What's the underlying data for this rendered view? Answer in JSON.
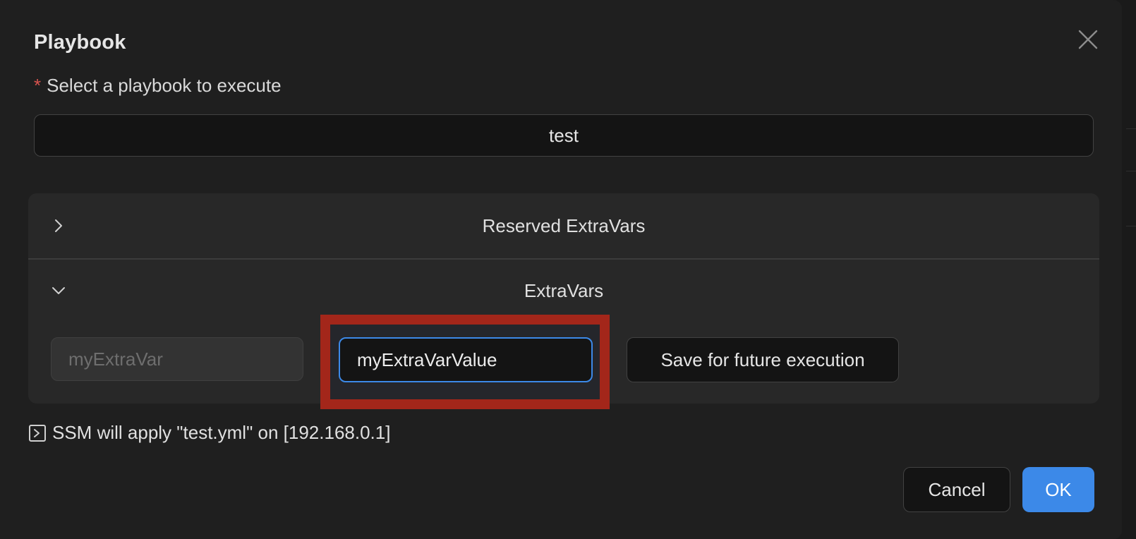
{
  "modal": {
    "title": "Playbook",
    "close_icon": "close-icon"
  },
  "playbook_field": {
    "required_mark": "*",
    "label": "Select a playbook to execute",
    "value": "test"
  },
  "collapse": {
    "reserved_panel": {
      "label": "Reserved ExtraVars",
      "expanded": false,
      "icon": "chevron-right-icon"
    },
    "extravars_panel": {
      "label": "ExtraVars",
      "expanded": true,
      "icon": "chevron-down-icon",
      "row": {
        "key": "myExtraVar",
        "value": "myExtraVarValue",
        "save_label": "Save for future execution"
      }
    }
  },
  "summary": {
    "icon": "terminal-icon",
    "text": "SSM will apply \"test.yml\" on [192.168.0.1]"
  },
  "footer": {
    "cancel_label": "Cancel",
    "ok_label": "OK"
  },
  "colors": {
    "primary": "#3c89e8",
    "highlight": "#a3261a",
    "required": "#d9534f",
    "modal_bg": "#1f1f1f"
  }
}
